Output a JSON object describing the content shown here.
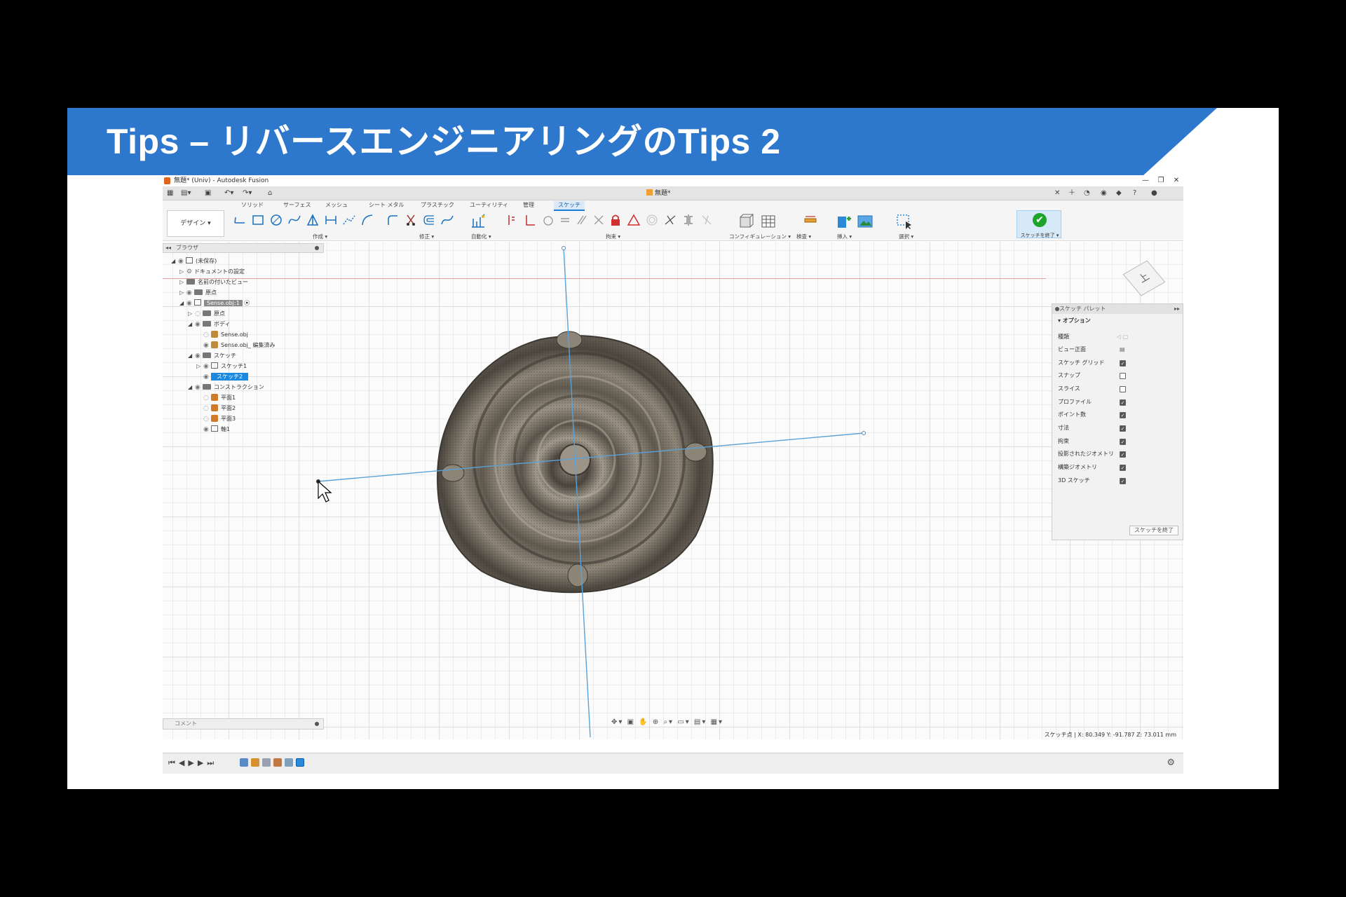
{
  "slide_title": "Tips – リバースエンジニアリングのTips 2",
  "window": {
    "title": "無題* (Univ) - Autodesk Fusion",
    "doc_tab": "無題*",
    "controls": [
      "—",
      "❐",
      "✕"
    ]
  },
  "ribbon": {
    "tabs": [
      "ソリッド",
      "サーフェス",
      "メッシュ",
      "シート メタル",
      "プラスチック",
      "ユーティリティ",
      "管理",
      "スケッチ"
    ],
    "active_tab": "スケッチ",
    "workspace": "デザイン ▾",
    "groups": [
      "作成 ▾",
      "修正 ▾",
      "自動化 ▾",
      "拘束 ▾",
      "コンフィギュレーション ▾",
      "検査 ▾",
      "挿入 ▾",
      "選択 ▾"
    ],
    "finish_sketch": "スケッチを終了 ▾",
    "accent": "#1a7fd4"
  },
  "browser": {
    "header": "ブラウザ",
    "nodes": [
      {
        "label": "(未保存)"
      },
      {
        "label": "ドキュメントの設定"
      },
      {
        "label": "名前の付いたビュー"
      },
      {
        "label": "原点"
      },
      {
        "label": "Sense.obj:1"
      },
      {
        "label": "原点"
      },
      {
        "label": "ボディ"
      },
      {
        "label": "Sense.obj"
      },
      {
        "label": "Sense.obj_ 編集済み"
      },
      {
        "label": "スケッチ"
      },
      {
        "label": "スケッチ1"
      },
      {
        "label": "スケッチ2"
      },
      {
        "label": "コンストラクション"
      },
      {
        "label": "平面1"
      },
      {
        "label": "平面2"
      },
      {
        "label": "平面3"
      },
      {
        "label": "軸1"
      }
    ]
  },
  "palette": {
    "title": "スケッチ パレット",
    "section": "オプション",
    "rows": [
      {
        "label": "種類",
        "checked": null
      },
      {
        "label": "ビュー正面",
        "checked": null
      },
      {
        "label": "スケッチ グリッド",
        "checked": true
      },
      {
        "label": "スナップ",
        "checked": false
      },
      {
        "label": "スライス",
        "checked": false
      },
      {
        "label": "プロファイル",
        "checked": true
      },
      {
        "label": "ポイント数",
        "checked": true
      },
      {
        "label": "寸法",
        "checked": true
      },
      {
        "label": "拘束",
        "checked": true
      },
      {
        "label": "投影されたジオメトリ",
        "checked": true
      },
      {
        "label": "構築ジオメトリ",
        "checked": true
      },
      {
        "label": "3D スケッチ",
        "checked": true
      }
    ],
    "finish_button": "スケッチを終了"
  },
  "comment_panel": "コメント",
  "status_text": "スケッチ点 | X: 80.349 Y: -91.787 Z: 73.011 mm",
  "viewcube_label": "上"
}
